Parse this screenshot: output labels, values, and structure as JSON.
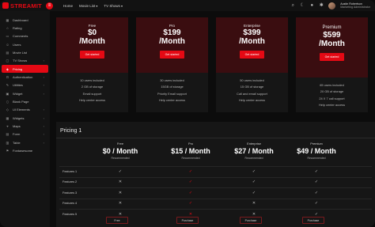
{
  "brand": {
    "name": "STREAMIT"
  },
  "topnav": {
    "items": [
      "Home",
      "Movie List",
      "TV Shows"
    ]
  },
  "user": {
    "name": "Austin Robertson",
    "role": "Marketing Administrator"
  },
  "sidebar": {
    "items": [
      {
        "label": "Dashboard",
        "icon": "dashboard-icon",
        "glyph": "▦"
      },
      {
        "label": "Rating",
        "icon": "star-icon",
        "glyph": "☆"
      },
      {
        "label": "Comments",
        "icon": "comment-icon",
        "glyph": "▭"
      },
      {
        "label": "Users",
        "icon": "users-icon",
        "glyph": "☺"
      },
      {
        "label": "Movie List",
        "icon": "film-icon",
        "glyph": "▤"
      },
      {
        "label": "TV Shows",
        "icon": "tv-icon",
        "glyph": "▢",
        "chev": "›"
      },
      {
        "label": "Pricing",
        "icon": "tag-icon",
        "glyph": "◈",
        "active": true
      },
      {
        "label": "Authentication",
        "icon": "lock-icon",
        "glyph": "⊡",
        "chev": "›"
      },
      {
        "label": "Utilities",
        "icon": "tool-icon",
        "glyph": "✎",
        "chev": "›"
      },
      {
        "label": "Widget",
        "icon": "widget-icon",
        "glyph": "▣",
        "chev": "›"
      },
      {
        "label": "Blank Page",
        "icon": "page-icon",
        "glyph": "▯"
      },
      {
        "label": "UI Elements",
        "icon": "layers-icon",
        "glyph": "◇",
        "chev": "›"
      },
      {
        "label": "Widgets",
        "icon": "grid-icon",
        "glyph": "▦",
        "chev": "›"
      },
      {
        "label": "Maps",
        "icon": "map-icon",
        "glyph": "⌖",
        "chev": "›"
      },
      {
        "label": "Form",
        "icon": "form-icon",
        "glyph": "▤",
        "chev": "›"
      },
      {
        "label": "Table",
        "icon": "table-icon",
        "glyph": "▥",
        "chev": "›"
      },
      {
        "label": "Fontawesome",
        "icon": "flag-icon",
        "glyph": "⚑"
      }
    ]
  },
  "cards": [
    {
      "plan": "Free",
      "price": "$0",
      "per": "/Month",
      "button": "Get started",
      "features": [
        "10 users included",
        "2 GB of storage",
        "Email support",
        "Help center access"
      ]
    },
    {
      "plan": "Pro",
      "price": "$199",
      "per": "/Month",
      "button": "Get started",
      "features": [
        "30 users included",
        "15GB of storage",
        "Priority Email support",
        "Help center access"
      ]
    },
    {
      "plan": "Enterprise",
      "price": "$399",
      "per": "/Month",
      "button": "Get started",
      "features": [
        "50 users included",
        "15 GB of storage",
        "Call and email support",
        "Help center access"
      ]
    },
    {
      "plan": "Premium",
      "price": "$599",
      "per": "/Month",
      "button": "Get started",
      "features": [
        "65 users included",
        "20 GB of storage",
        "24 X 7 call support",
        "Help center access"
      ]
    }
  ],
  "pricing_table": {
    "title": "Pricing 1",
    "columns": [
      {
        "name": "Free",
        "price": "$0 / Month",
        "note": "Recommended"
      },
      {
        "name": "Pro",
        "price": "$15 / Month",
        "note": "Recommended"
      },
      {
        "name": "Enterprise",
        "price": "$27 / Month",
        "note": "Recommended"
      },
      {
        "name": "Premium",
        "price": "$49 / Month",
        "note": "Recommended"
      }
    ],
    "rows": [
      {
        "name": "Features 1",
        "marks": [
          "yes",
          "red-yes",
          "yes",
          "yes"
        ]
      },
      {
        "name": "Features 2",
        "marks": [
          "no",
          "red-yes",
          "yes",
          "yes"
        ]
      },
      {
        "name": "Features 3",
        "marks": [
          "no",
          "red-yes",
          "yes",
          "yes"
        ]
      },
      {
        "name": "Features 4",
        "marks": [
          "no",
          "red-yes",
          "no",
          "yes"
        ]
      },
      {
        "name": "Features 5",
        "marks": [
          "no",
          "red-no",
          "no",
          "yes"
        ]
      }
    ],
    "buttons": [
      "Free",
      "Purchase",
      "Purchase",
      "Purchase"
    ]
  },
  "colors": {
    "accent": "#e50914",
    "card_head": "#3a0d10",
    "panel": "#161616"
  }
}
